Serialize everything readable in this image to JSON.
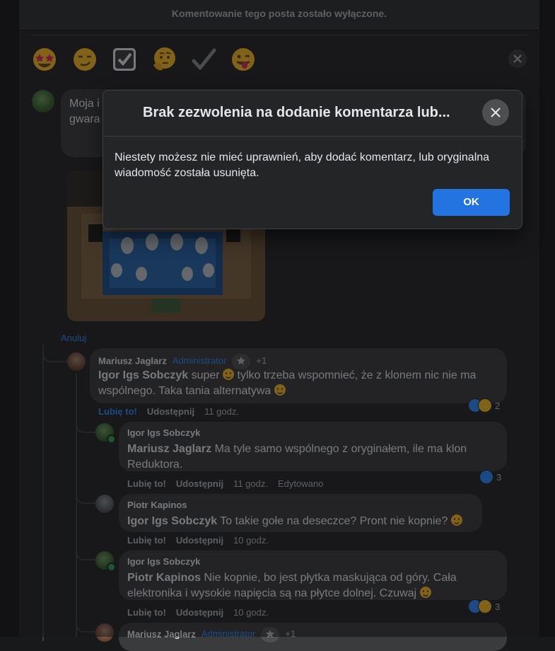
{
  "post": {
    "comments_disabled_text": "Komentowanie tego posta zostało wyłączone."
  },
  "reaction_picker": {
    "emojis": [
      "star-struck",
      "smirk",
      "check-box",
      "thinking",
      "check-mark",
      "winking-tongue"
    ]
  },
  "composer": {
    "text_line1": "Moja i",
    "text_line2": "gwara",
    "cancel_label": "Anuluj"
  },
  "comments": [
    {
      "author": "Mariusz Jaglarz",
      "role": "Administrator",
      "badge_count": "+1",
      "mention": "Igor Igs Sobczyk",
      "text_a": " super ",
      "text_b": " tylko trzeba wspomnieć, że z klonem nic nie ma wspólnego. Taka tania alternatywa ",
      "like_label": "Lubię to!",
      "share_label": "Udostępnij",
      "time": "11 godz.",
      "reaction_count": "2"
    },
    {
      "author": "Igor Igs Sobczyk",
      "mention": "Mariusz Jaglarz",
      "text": " Ma tyle samo wspólnego z oryginałem, ile ma klon Reduktora.",
      "like_label": "Lubię to!",
      "share_label": "Udostępnij",
      "time": "11 godz.",
      "edited_label": "Edytowano",
      "reaction_count": "3"
    },
    {
      "author": "Piotr Kapinos",
      "mention": "Igor Igs Sobczyk",
      "text": " To takie gołe na deseczce? Pront nie kopnie? ",
      "like_label": "Lubię to!",
      "share_label": "Udostępnij",
      "time": "10 godz."
    },
    {
      "author": "Igor Igs Sobczyk",
      "mention": "Piotr Kapinos",
      "text": " Nie kopnie, bo jest płytka maskująca od góry. Cała elektronika i wysokie napięcia są na płytce dolnej. Czuwaj ",
      "like_label": "Lubię to!",
      "share_label": "Udostępnij",
      "time": "10 godz.",
      "reaction_count": "3"
    },
    {
      "author": "Mariusz Jaglarz",
      "role": "Administrator",
      "badge_count": "+1"
    }
  ],
  "modal": {
    "title": "Brak zezwolenia na dodanie komentarza lub...",
    "body": "Niestety możesz nie mieć uprawnień, aby dodać komentarz, lub oryginalna wiadomość została usunięta.",
    "ok_label": "OK"
  },
  "colors": {
    "background": "#18191a",
    "card": "#242526",
    "bubble": "#3a3b3c",
    "accent": "#2d88ff",
    "ok_button": "#2374e1",
    "admin_label": "#2d88ff"
  }
}
